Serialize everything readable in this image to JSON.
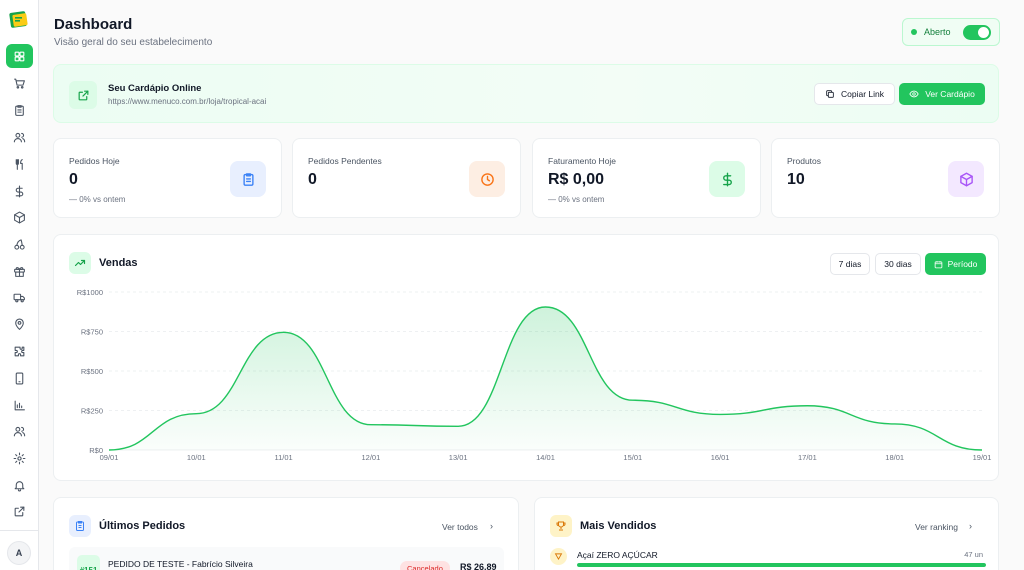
{
  "sidebar": {
    "items": [
      {
        "name": "dashboard",
        "icon": "grid-icon",
        "active": true
      },
      {
        "name": "orders",
        "icon": "cart-icon"
      },
      {
        "name": "menu",
        "icon": "clipboard-icon"
      },
      {
        "name": "customers",
        "icon": "users-icon"
      },
      {
        "name": "products",
        "icon": "utensils-icon"
      },
      {
        "name": "finance",
        "icon": "dollar-icon"
      },
      {
        "name": "inventory",
        "icon": "box-icon"
      },
      {
        "name": "categories",
        "icon": "cherries-icon"
      },
      {
        "name": "promotions",
        "icon": "gift-icon"
      },
      {
        "name": "delivery",
        "icon": "truck-icon"
      },
      {
        "name": "locations",
        "icon": "map-pin-icon"
      },
      {
        "name": "integrations",
        "icon": "puzzle-icon"
      },
      {
        "name": "app",
        "icon": "smartphone-icon"
      },
      {
        "name": "reports",
        "icon": "bar-chart-icon"
      },
      {
        "name": "team",
        "icon": "users-icon"
      },
      {
        "name": "settings",
        "icon": "gear-icon"
      },
      {
        "name": "notifications",
        "icon": "bell-icon"
      },
      {
        "name": "external",
        "icon": "external-link-icon"
      }
    ],
    "avatar_initial": "A"
  },
  "header": {
    "title": "Dashboard",
    "subtitle": "Visão geral do seu estabelecimento",
    "status_label": "Aberto",
    "status_open": true
  },
  "banner": {
    "title": "Seu Cardápio Online",
    "url": "https://www.menuco.com.br/loja/tropical-acai",
    "copy_label": "Copiar Link",
    "view_label": "Ver Cardápio"
  },
  "stats": [
    {
      "label": "Pedidos Hoje",
      "value": "0",
      "change": "—  0%  vs ontem",
      "icon": "clipboard-icon",
      "color": "#3b82f6",
      "bg": "#e8effe"
    },
    {
      "label": "Pedidos Pendentes",
      "value": "0",
      "change": "",
      "icon": "clock-icon",
      "color": "#f97316",
      "bg": "#fdeee3"
    },
    {
      "label": "Faturamento Hoje",
      "value": "R$ 0,00",
      "change": "—  0%  vs ontem",
      "icon": "dollar-icon",
      "color": "#16a34a",
      "bg": "#dcfce7"
    },
    {
      "label": "Produtos",
      "value": "10",
      "change": "",
      "icon": "box-icon",
      "color": "#a855f7",
      "bg": "#f3e8ff"
    }
  ],
  "sales": {
    "title": "Vendas",
    "range_7": "7 dias",
    "range_30": "30 dias",
    "range_period": "Período"
  },
  "chart_data": {
    "type": "area",
    "title": "Vendas",
    "x": [
      "09/01",
      "10/01",
      "11/01",
      "12/01",
      "13/01",
      "14/01",
      "15/01",
      "16/01",
      "17/01",
      "18/01",
      "19/01"
    ],
    "series": [
      {
        "values": [
          0,
          230,
          745,
          160,
          150,
          905,
          315,
          225,
          280,
          165,
          0
        ]
      }
    ],
    "y_ticks": [
      "R$0",
      "R$250",
      "R$500",
      "R$750",
      "R$1000"
    ],
    "ylim": [
      0,
      1000
    ],
    "grid": true,
    "color": "#22c55e"
  },
  "recent_orders": {
    "title": "Últimos Pedidos",
    "link": "Ver todos",
    "rows": [
      {
        "number": "#151",
        "name": "PEDIDO DE TESTE - Fabrício Silveira",
        "status": "Cancelado",
        "total": "R$ 26,89"
      }
    ]
  },
  "top_sellers": {
    "title": "Mais Vendidos",
    "link": "Ver ranking",
    "items": [
      {
        "name": "Açaí ZERO AÇÚCAR",
        "count": "47 un",
        "fraction": 1.0
      }
    ]
  }
}
